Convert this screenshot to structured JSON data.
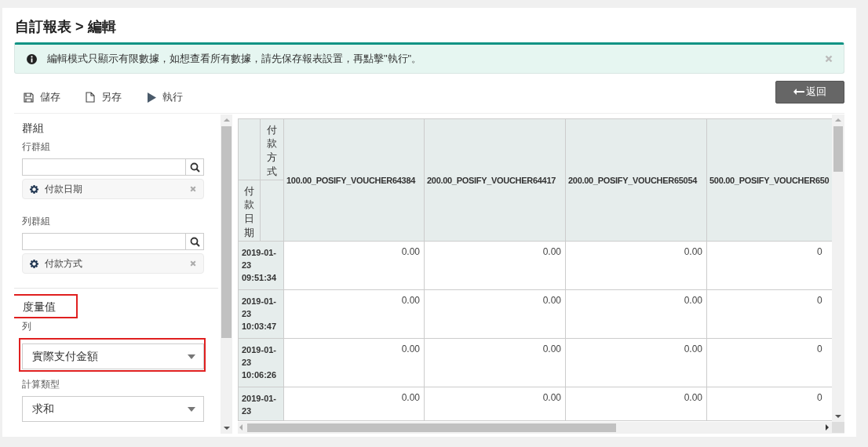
{
  "page": {
    "title": "自訂報表 > 編輯"
  },
  "alert": {
    "message": "編輯模式只顯示有限數據，如想查看所有數據，請先保存報表設置，再點擊\"執行\"。"
  },
  "toolbar": {
    "actions": [
      {
        "kind": "save",
        "label": "儲存"
      },
      {
        "kind": "save-as",
        "label": "另存"
      },
      {
        "kind": "run",
        "label": "執行"
      }
    ],
    "back_button": "返回"
  },
  "groups": {
    "title": "群組",
    "sections": [
      {
        "label": "行群組",
        "tags": [
          {
            "label": "付款日期"
          }
        ]
      },
      {
        "label": "列群組",
        "tags": [
          {
            "label": "付款方式"
          }
        ]
      }
    ]
  },
  "measures": {
    "title": "度量值",
    "highlighted": true,
    "fields": [
      {
        "label": "列",
        "value": "實際支付金額",
        "highlighted": true
      },
      {
        "label": "計算類型",
        "value": "求和",
        "highlighted": false
      }
    ]
  },
  "pivot": {
    "column_field": "付款方式",
    "row_field": "付款日期",
    "columns": [
      "100.00_POSIFY_VOUCHER64384",
      "200.00_POSIFY_VOUCHER64417",
      "200.00_POSIFY_VOUCHER65054",
      "500.00_POSIFY_VOUCHER650"
    ],
    "rows": [
      {
        "label": "2019-01-23 09:51:34",
        "values": [
          "0.00",
          "0.00",
          "0.00",
          "0"
        ]
      },
      {
        "label": "2019-01-23 10:03:47",
        "values": [
          "0.00",
          "0.00",
          "0.00",
          "0"
        ]
      },
      {
        "label": "2019-01-23 10:06:26",
        "values": [
          "0.00",
          "0.00",
          "0.00",
          "0"
        ]
      },
      {
        "label": "2019-01-23",
        "values": [
          "0.00",
          "0.00",
          "0.00",
          "0"
        ]
      }
    ]
  }
}
